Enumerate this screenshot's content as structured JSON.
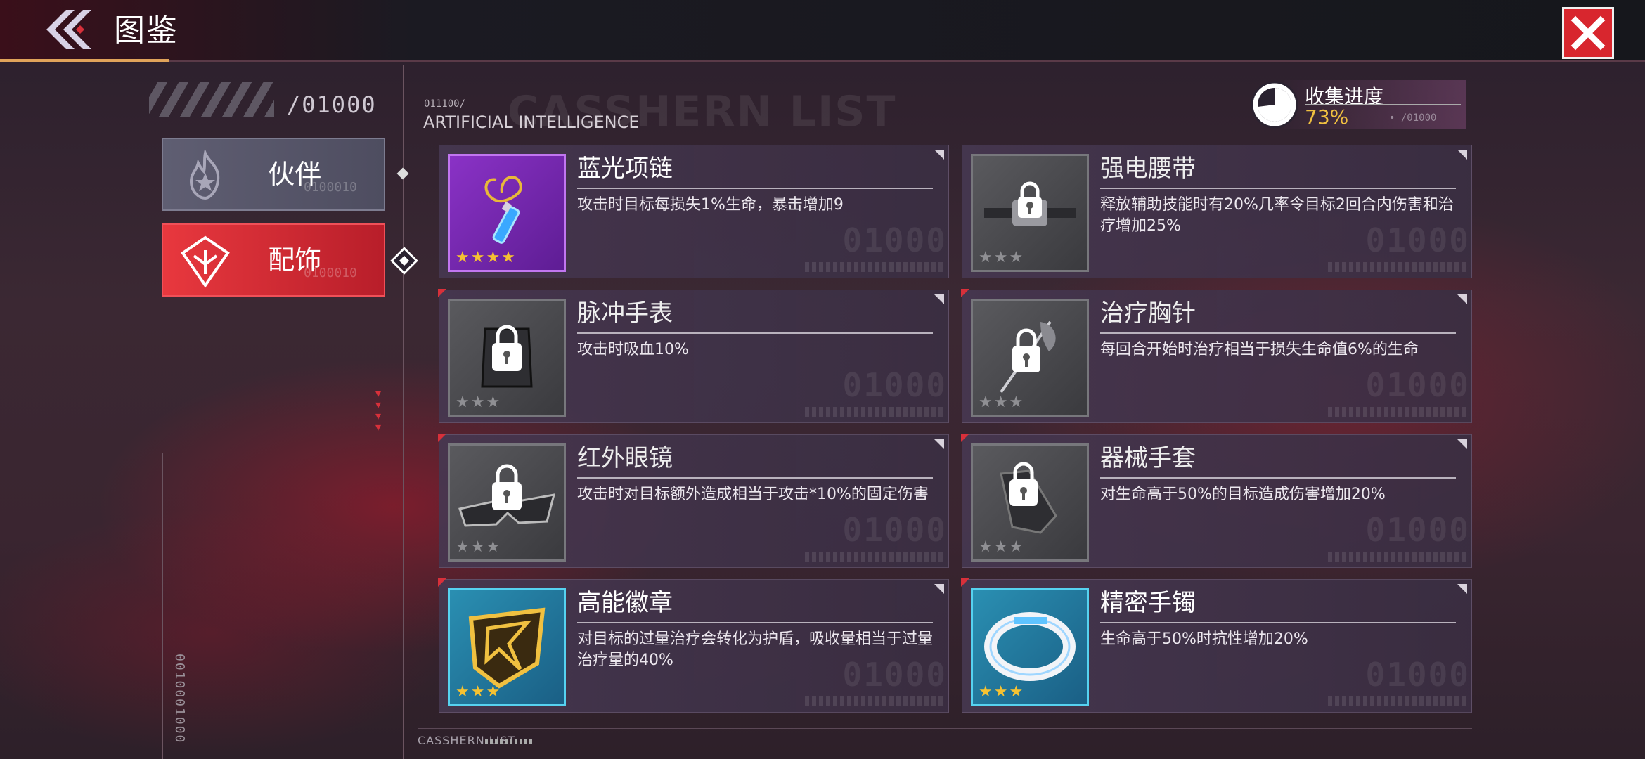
{
  "header": {
    "title": "图鉴"
  },
  "left_panel": {
    "count": "/01000",
    "tabs": [
      {
        "label": "伙伴",
        "watermark": "0100010"
      },
      {
        "label": "配饰",
        "watermark": "0100010"
      }
    ],
    "side_code": "0010001000"
  },
  "list_header": {
    "code": "011100/",
    "subtitle": "ARTIFICIAL INTELLIGENCE",
    "ghost_title": "CASSHERN LIST"
  },
  "collection": {
    "label": "收集进度",
    "value": "73%",
    "code": "• /01000",
    "progress_fraction": 0.73
  },
  "items": [
    {
      "name": "蓝光项链",
      "desc": "攻击时目标每损失1%生命，暴击增加9",
      "stars": "★★★★",
      "rarity": "purple",
      "locked": false,
      "watermark": "01000"
    },
    {
      "name": "强电腰带",
      "desc": "释放辅助技能时有20%几率令目标2回合内伤害和治疗增加25%",
      "stars": "★★★",
      "rarity": "gray",
      "locked": true,
      "watermark": "01000"
    },
    {
      "name": "脉冲手表",
      "desc": "攻击时吸血10%",
      "stars": "★★★",
      "rarity": "gray",
      "locked": true,
      "watermark": "01000"
    },
    {
      "name": "治疗胸针",
      "desc": "每回合开始时治疗相当于损失生命值6%的生命",
      "stars": "★★★",
      "rarity": "gray",
      "locked": true,
      "watermark": "01000"
    },
    {
      "name": "红外眼镜",
      "desc": "攻击时对目标额外造成相当于攻击*10%的固定伤害",
      "stars": "★★★",
      "rarity": "gray",
      "locked": true,
      "watermark": "01000"
    },
    {
      "name": "器械手套",
      "desc": "对生命高于50%的目标造成伤害增加20%",
      "stars": "★★★",
      "rarity": "gray",
      "locked": true,
      "watermark": "01000"
    },
    {
      "name": "高能徽章",
      "desc": "对目标的过量治疗会转化为护盾，吸收量相当于过量治疗量的40%",
      "stars": "★★★",
      "rarity": "teal",
      "locked": false,
      "watermark": "01000"
    },
    {
      "name": "精密手镯",
      "desc": "生命高于50%时抗性增加20%",
      "stars": "★★★",
      "rarity": "teal",
      "locked": false,
      "watermark": "01000"
    }
  ],
  "footer": {
    "label": "CASSHERN LIST"
  },
  "colors": {
    "accent_red": "#d8303a",
    "gold": "#f0c040",
    "purple_rarity": "#8a32c6",
    "teal_rarity": "#2a8fb2",
    "gray_rarity": "#5a5a5e"
  }
}
